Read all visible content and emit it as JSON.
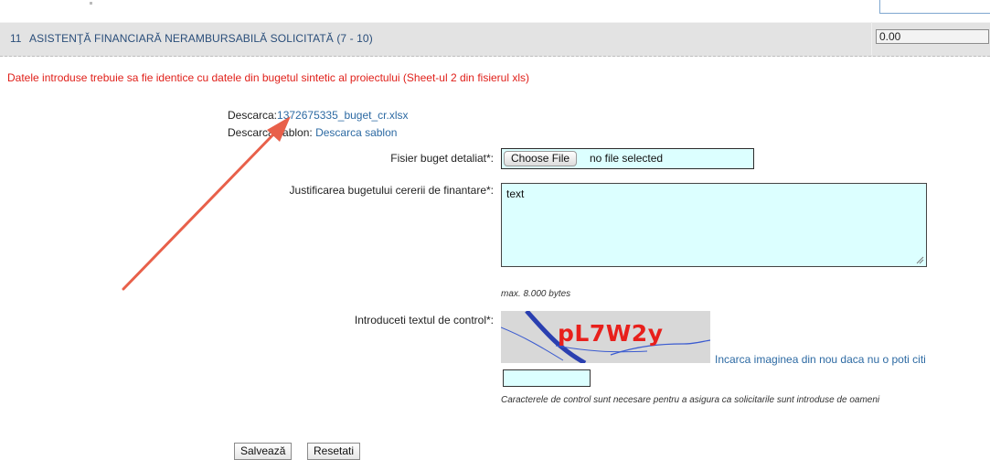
{
  "row11": {
    "number": "11",
    "label": "ASISTENŢĂ FINANCIARĂ NERAMBURSABILĂ SOLICITATĂ (7 - 10)",
    "value": "0.00"
  },
  "warning": "Datele introduse trebuie sa fie identice cu datele din bugetul sintetic al proiectului (Sheet-ul 2 din fisierul xls)",
  "download": {
    "label": "Descarca:",
    "file_name": "1372675335_buget_cr.xlsx",
    "template_label": "Descarca sablon:",
    "template_link": "Descarca sablon"
  },
  "budget_file": {
    "label": "Fisier buget detaliat*:",
    "button": "Choose File",
    "status": "no file selected"
  },
  "justification": {
    "label": "Justificarea bugetului cererii de finantare*:",
    "value": "text",
    "hint": "max. 8.000 bytes"
  },
  "captcha": {
    "label": "Introduceti textul de control*:",
    "image_text": "pL7W2y",
    "reload_link": "Incarca imaginea din nou daca nu o poti citi",
    "input_value": "",
    "hint": "Caracterele de control sunt necesare pentru a asigura ca solicitarile sunt introduse de oameni"
  },
  "buttons": {
    "save": "Salvează",
    "reset": "Resetati"
  },
  "colors": {
    "warning": "#e0201a",
    "link": "#2d6aa3",
    "input_bg": "#dcffff",
    "row_bg": "#e3e3e3",
    "annotation_arrow": "#e8604a"
  },
  "icons": [
    "resize-grip-icon",
    "annotation-arrow-icon"
  ]
}
